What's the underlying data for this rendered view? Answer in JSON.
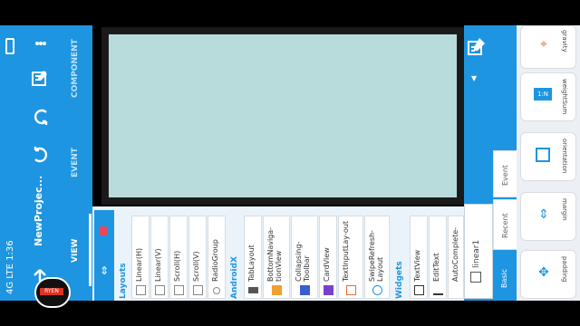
{
  "status": {
    "time": "1:36",
    "signal": "4G LTE",
    "dot": "•"
  },
  "appbar": {
    "project_title": "NewProjec..."
  },
  "tabs": [
    {
      "label": "VIEW"
    },
    {
      "label": "EVENT"
    },
    {
      "label": "COMPONENT"
    }
  ],
  "palette": {
    "groups": [
      {
        "title": "Layouts",
        "items": [
          "Linear(H)",
          "Linear(V)",
          "Scroll(H)",
          "Scroll(V)",
          "RadioGroup"
        ]
      },
      {
        "title": "AndroidX",
        "items": [
          "TabLayout",
          "BottomNaviga-tionView",
          "Collapsing-Toolbar",
          "CardView",
          "TextInputLay-out",
          "SwipeRefresh-Layout"
        ]
      },
      {
        "title": "Widgets",
        "items": [
          "TextView",
          "EditText",
          "AutoComplete-"
        ]
      }
    ]
  },
  "right_panel": {
    "selected_view": "linear1",
    "tabs": [
      {
        "label": "Basic"
      },
      {
        "label": "Recent"
      },
      {
        "label": "Event"
      }
    ]
  },
  "properties": [
    {
      "label": "padding",
      "icon": "padding-icon"
    },
    {
      "label": "margin",
      "icon": "margin-icon"
    },
    {
      "label": "orientation",
      "icon": "orientation-icon"
    },
    {
      "label": "weightSum",
      "icon": "weightsum-icon",
      "badge": "1:N"
    },
    {
      "label": "gravity",
      "icon": "gravity-icon"
    }
  ],
  "colors": {
    "primary": "#1e95e0",
    "canvas": "#b8dcdc",
    "accent": "#e5702b"
  }
}
